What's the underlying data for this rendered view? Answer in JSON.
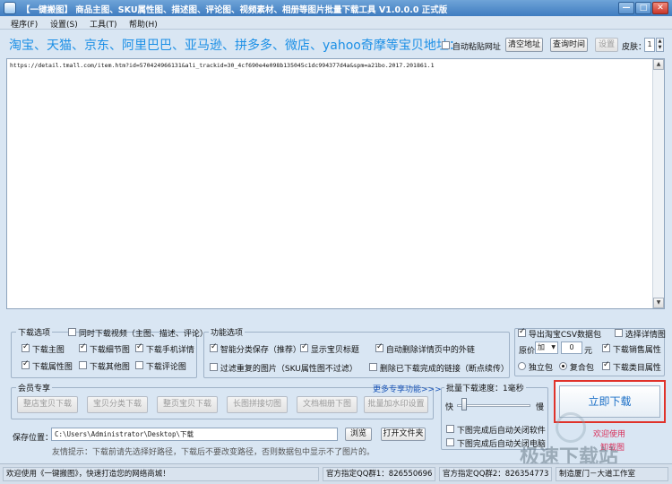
{
  "window": {
    "title": "【一键搬图】 商品主图、SKU属性图、描述图、评论图、视频素材、相册等图片批量下载工具 V1.0.0.0 正式版",
    "min": "—",
    "max": "□",
    "close": "✕"
  },
  "menu": [
    "程序(F)",
    "设置(S)",
    "工具(T)",
    "帮助(H)"
  ],
  "address": {
    "label": "淘宝、天猫、京东、阿里巴巴、亚马逊、拼多多、微店、yahoo奇摩等宝贝地址：",
    "auto_paste": "自动粘贴网址",
    "clear_btn": "清空地址",
    "query_time_btn": "查询时间",
    "settings_btn": "设置",
    "skin_label": "皮肤：",
    "skin_value": "1",
    "url_text": "https://detail.tmall.com/item.htm?id=570424966131&ali_trackid=30_4cf690e4e098b135045c1dc994377d4a&spm=a21bo.2017.201861.1"
  },
  "download_options": {
    "title": "下载选项",
    "sync_video": "同时下载视频（主图、描述、评论）",
    "items": [
      {
        "label": "下载主图",
        "checked": true
      },
      {
        "label": "下载细节图",
        "checked": true
      },
      {
        "label": "下载手机详情",
        "checked": true
      },
      {
        "label": "下载属性图",
        "checked": true
      },
      {
        "label": "下载其他图",
        "checked": false
      },
      {
        "label": "下载评论图",
        "checked": false
      }
    ]
  },
  "function_options": {
    "title": "功能选项",
    "items": [
      {
        "label": "智能分类保存（推荐）",
        "checked": true
      },
      {
        "label": "显示宝贝标题",
        "checked": true
      },
      {
        "label": "自动删除详情页中的外链",
        "checked": true
      },
      {
        "label": "过滤重复的图片（SKU属性图不过滤）",
        "checked": false
      },
      {
        "label": "删除已下载完成的链接（断点续传）",
        "checked": false
      }
    ]
  },
  "right_options": {
    "export_csv": "导出淘宝CSV数据包",
    "select_details": "选择详情图",
    "price_label": "原价",
    "price_op": "加",
    "price_value": "0",
    "price_unit": "元",
    "download_sales": "下载销售属性",
    "standalone": "独立包",
    "combined": "复合包",
    "download_category": "下载类目属性"
  },
  "member": {
    "title": "会员专享",
    "more": "更多专享功能>>>",
    "buttons": [
      "整店宝贝下载",
      "宝贝分类下载",
      "整页宝贝下载",
      "长图拼接切图",
      "文档相册下图",
      "批量加水印设置"
    ]
  },
  "speed": {
    "title": "批量下载速度：1毫秒",
    "fast": "快",
    "slow": "慢",
    "slider_fraction": 0.06,
    "auto_close_software": "下图完成后自动关闭软件",
    "auto_close_pc": "下图完成后自动关闭电脑"
  },
  "save": {
    "label": "保存位置：",
    "path": "C:\\Users\\Administrator\\Desktop\\下载",
    "browse": "浏览",
    "open_folder": "打开文件夹",
    "tip": "友情提示：下载前请先选择好路径，下载后不要改变路径，否则数据包中显示不了图片的。"
  },
  "download_button": "立即下载",
  "welcome_link": "欢迎使用",
  "uninstall_link": "卸载图",
  "status": {
    "welcome": "欢迎使用《一键搬图》，快速打造您的网络商城！",
    "qq1": "官方指定QQ群1：826550696",
    "qq2": "官方指定QQ群2：826354773",
    "maker": "制造厦门－大道工作室"
  },
  "watermark": "极速下载站"
}
